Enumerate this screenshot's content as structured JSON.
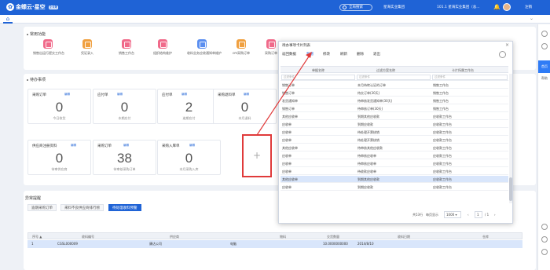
{
  "header": {
    "brand": "金蝶云·星空",
    "brand_badge": "企业版",
    "search_placeholder": "全局搜索",
    "org_name": "星海实业集团",
    "org_select": "101.1 星海实业集团（总...",
    "logout": "注销"
  },
  "common_functions": {
    "title": "常用功能",
    "items": [
      {
        "label": "销售出运行提交工作台",
        "color": "#f06a8a"
      },
      {
        "label": "凭证录入",
        "color": "#f0a040"
      },
      {
        "label": "销售工作台",
        "color": "#f06a8a"
      },
      {
        "label": "组织结构维护",
        "color": "#f06a8a"
      },
      {
        "label": "收料业务应收通知单维护",
        "color": "#5b8ff0"
      },
      {
        "label": "cm采购订单",
        "color": "#f0a040"
      },
      {
        "label": "采购订单",
        "color": "#f06a8a"
      }
    ]
  },
  "todo": {
    "title": "待办事项",
    "cards": [
      {
        "name": "采购订单",
        "tag": "编辑",
        "value": "0",
        "sub": "今日收货"
      },
      {
        "name": "应付单",
        "tag": "编辑",
        "value": "0",
        "sub": "本期应付"
      },
      {
        "name": "应付单",
        "tag": "编辑",
        "value": "2",
        "sub": "逾期应付"
      },
      {
        "name": "采购退料单",
        "tag": "编辑",
        "value": "0",
        "sub": "本月退料"
      },
      {
        "name": "供应商注册资料",
        "tag": "编辑",
        "value": "0",
        "sub": "待审供应商"
      },
      {
        "name": "采购订单",
        "tag": "编辑",
        "value": "38",
        "sub": "待审核采购订单"
      },
      {
        "name": "采购入库单",
        "tag": "编辑",
        "value": "0",
        "sub": "本月采购入库"
      }
    ]
  },
  "exceptions": {
    "title": "异常提醒",
    "tabs": [
      "逾期采购订单",
      "来料不良供应商排行榜",
      "待处理收料预警"
    ],
    "columns": [
      "序号 ▲",
      "收料编号",
      "供应商",
      "物料",
      "交货数量",
      "收料日期",
      "仓库"
    ],
    "rows": [
      {
        "seq": "1",
        "receipt_no": "CGSL000009",
        "supplier": "康达公司",
        "material": "电脑",
        "qty": "10.0000000000",
        "date": "2014/8/10",
        "warehouse": ""
      }
    ]
  },
  "modal": {
    "title": "待办事项卡片列表",
    "toolbar": [
      "返回数据",
      "新增",
      "修改",
      "刷新",
      "删除",
      "退出"
    ],
    "columns": [
      "单据名称",
      "过滤方案名称",
      "卡片所属工作台"
    ],
    "filter_placeholders": [
      "过滤条件",
      "过滤条件",
      "过滤条件"
    ],
    "rows": [
      [
        "销售订单",
        "本月待转认证的订单",
        "销售工作台"
      ],
      [
        "销售订单",
        "待交订单(30天)",
        "销售工作台"
      ],
      [
        "发货通知单",
        "待审核发货通知单(30天)",
        "销售工作台"
      ],
      [
        "销售订单",
        "待审核订单(30天)",
        "销售工作台"
      ],
      [
        "其他应收单",
        "到期其他应收款",
        "应收款工作台"
      ],
      [
        "应收单",
        "到期应收款",
        "应收款工作台"
      ],
      [
        "应收单",
        "待处理开票核销",
        "应收款工作台"
      ],
      [
        "应收单",
        "待处理开票核销",
        "应收款工作台"
      ],
      [
        "其他应收单",
        "待审核其他应收款",
        "应收款工作台"
      ],
      [
        "应收单",
        "待审核应收单",
        "应收款工作台"
      ],
      [
        "应收单",
        "待审核应收单",
        "应收款工作台"
      ],
      [
        "应收单",
        "待收款应收单",
        "应收款工作台"
      ],
      [
        "其他应收单",
        "到期其他应收款",
        "应收款工作台"
      ],
      [
        "应收单",
        "到期应收款",
        "应收款工作台"
      ]
    ],
    "selected_row": 12,
    "pager": {
      "total": "共53行",
      "per_page_label": "每页显示",
      "per_page": "1000",
      "page": "1",
      "of": "/ 1"
    }
  },
  "rail": {
    "btn": "首页",
    "txt": "帮助"
  },
  "colors": {
    "primary": "#1f63d6",
    "highlight": "#e03a3a"
  }
}
